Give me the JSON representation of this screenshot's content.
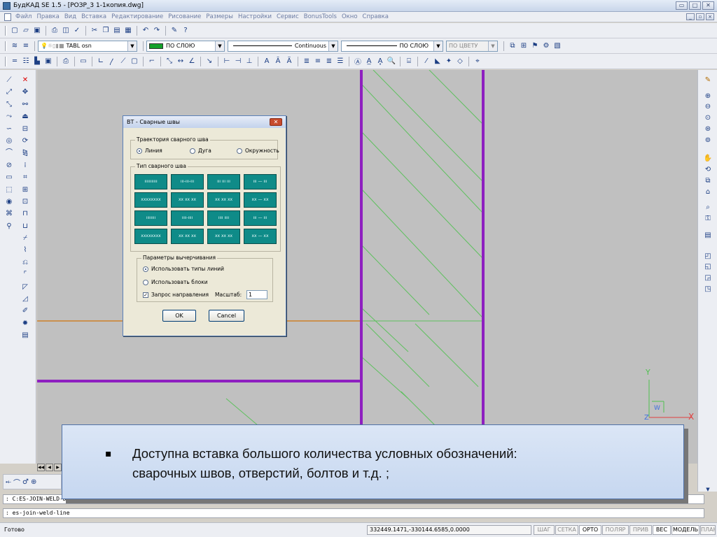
{
  "window": {
    "title": "БудКАД SE 1.5 - [РОЗР_3 1-1копия.dwg]",
    "min": "▭",
    "max": "□",
    "close": "✕"
  },
  "menu": [
    "Файл",
    "Правка",
    "Вид",
    "Вставка",
    "Редактирование",
    "Рисование",
    "Размеры",
    "Настройки",
    "Сервис",
    "BonusTools",
    "Окно",
    "Справка"
  ],
  "layers": {
    "current": "TABL osn",
    "color": "ПО СЛОЮ",
    "linetype": "Continuous",
    "lineweight": "ПО СЛОЮ",
    "plotstyle": "ПО ЦВЕТУ"
  },
  "dialog": {
    "title": "ВТ - Сварные швы",
    "trajectory": {
      "label": "Траектория сварного шва",
      "options": [
        "Линия",
        "Дуга",
        "Окружность"
      ],
      "selected": "Линия"
    },
    "weld_type": {
      "label": "Тип сварного шва",
      "buttons": [
        "ııııııııııı",
        "ııı-ııı-ııı",
        "ııı ııı ııı",
        "ııı — ııı",
        "xxxxxxxx",
        "xx xx xx",
        "xx xx xx",
        "xx — xx",
        "ıııııııı",
        "ıııı-ıııı",
        "ıııı ıııı",
        "ııı — ııı",
        "xxxxxxxx",
        "xx xx xx",
        "xx xx xx",
        "xx — xx"
      ]
    },
    "drawing_params": {
      "label": "Параметры вычерчивания",
      "use_linetypes": "Использовать типы линий",
      "use_blocks": "Использовать блоки",
      "ask_direction": "Запрос направления",
      "scale_label": "Масштаб:",
      "scale_value": "1"
    },
    "ok": "OK",
    "cancel": "Cancel"
  },
  "ucs": {
    "y": "Y",
    "x": "X",
    "w": "W"
  },
  "callout": {
    "bullet": "▪",
    "line1": "Доступна вставка большого количества  условных обозначений:",
    "line2": "сварочных швов, отверстий, болтов и т.д. ;"
  },
  "command": {
    "line1": ": C:ES-JOIN-WELD-DIRECT",
    "line2": ": es-join-weld-line"
  },
  "status": {
    "ready": "Готово",
    "coords": "332449.1471,-330144.6585,0.0000",
    "buttons": [
      {
        "label": "ШАГ",
        "on": false
      },
      {
        "label": "СЕТКА",
        "on": false
      },
      {
        "label": "ОРТО",
        "on": true
      },
      {
        "label": "ПОЛЯР",
        "on": false
      },
      {
        "label": "ПРИВ",
        "on": false
      },
      {
        "label": "ВЕС",
        "on": true
      },
      {
        "label": "МОДЕЛЬ",
        "on": true
      },
      {
        "label": "ПЛАНШЕТ",
        "on": false
      }
    ]
  },
  "colors": {
    "purple": "#8e1fc0",
    "green": "#5ec05e",
    "orange": "#d0730a",
    "bg": "#c0c0c0",
    "teal": "#0f8b88"
  }
}
